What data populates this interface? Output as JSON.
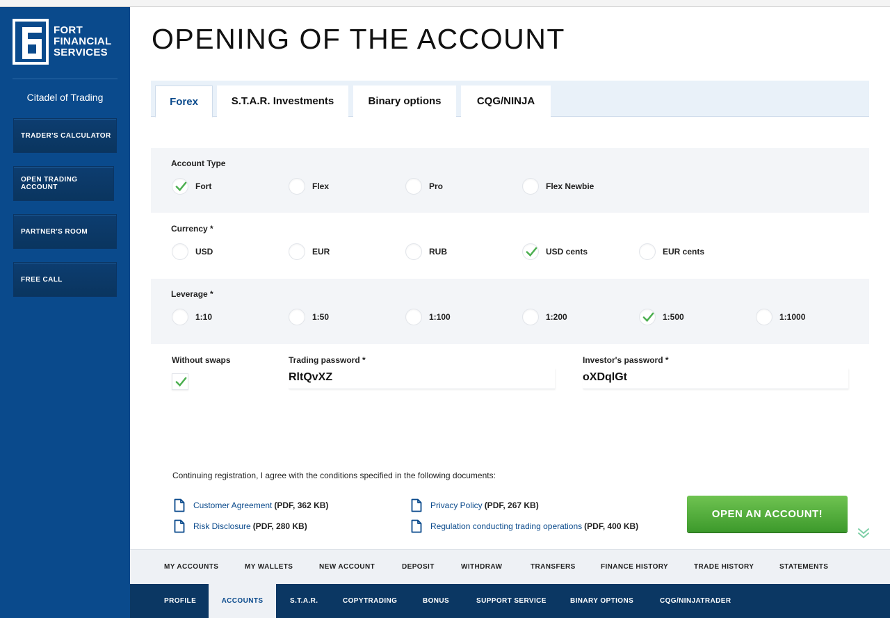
{
  "brand": {
    "logo_text": [
      "FORT",
      "FINANCIAL",
      "SERVICES"
    ],
    "tagline": "Citadel of Trading",
    "color_primary": "#0a4a8c",
    "color_accent": "#4caf50"
  },
  "sidebar": {
    "items": [
      {
        "label": "TRADER'S CALCULATOR"
      },
      {
        "label": "OPEN TRADING ACCOUNT"
      },
      {
        "label": "PARTNER'S ROOM"
      },
      {
        "label": "FREE CALL"
      }
    ]
  },
  "page": {
    "title": "OPENING OF THE ACCOUNT"
  },
  "tabs": [
    {
      "label": "Forex",
      "active": true
    },
    {
      "label": "S.T.A.R. Investments",
      "active": false
    },
    {
      "label": "Binary options",
      "active": false
    },
    {
      "label": "CQG/NINJA",
      "active": false
    }
  ],
  "account_type": {
    "label": "Account Type",
    "options": [
      {
        "label": "Fort",
        "selected": true
      },
      {
        "label": "Flex",
        "selected": false
      },
      {
        "label": "Pro",
        "selected": false
      },
      {
        "label": "Flex Newbie",
        "selected": false
      }
    ]
  },
  "currency": {
    "label": "Currency *",
    "options": [
      {
        "label": "USD",
        "selected": false
      },
      {
        "label": "EUR",
        "selected": false
      },
      {
        "label": "RUB",
        "selected": false
      },
      {
        "label": "USD cents",
        "selected": true
      },
      {
        "label": "EUR cents",
        "selected": false
      }
    ]
  },
  "leverage": {
    "label": "Leverage *",
    "options": [
      {
        "label": "1:10",
        "selected": false
      },
      {
        "label": "1:50",
        "selected": false
      },
      {
        "label": "1:100",
        "selected": false
      },
      {
        "label": "1:200",
        "selected": false
      },
      {
        "label": "1:500",
        "selected": true
      },
      {
        "label": "1:1000",
        "selected": false
      }
    ]
  },
  "swaps": {
    "label": "Without swaps",
    "checked": true
  },
  "trading_password": {
    "label": "Trading password *",
    "value": "RltQvXZ"
  },
  "investor_password": {
    "label": "Investor's password *",
    "value": "oXDqlGt"
  },
  "agreement": {
    "text": "Continuing registration, I agree with the conditions specified in the following documents:",
    "documents": [
      {
        "link": "Customer Agreement",
        "size": "(PDF, 362 KB)"
      },
      {
        "link": "Risk Disclosure",
        "size": "(PDF, 280 KB)"
      },
      {
        "link": "Privacy Policy",
        "size": "(PDF, 267 KB)"
      },
      {
        "link": "Regulation conducting trading operations",
        "size": "(PDF, 400 KB)"
      }
    ]
  },
  "submit": {
    "label": "OPEN AN ACCOUNT!"
  },
  "bottom_nav_primary": [
    {
      "label": "MY ACCOUNTS"
    },
    {
      "label": "MY WALLETS"
    },
    {
      "label": "NEW ACCOUNT"
    },
    {
      "label": "DEPOSIT"
    },
    {
      "label": "WITHDRAW"
    },
    {
      "label": "TRANSFERS"
    },
    {
      "label": "FINANCE HISTORY"
    },
    {
      "label": "TRADE HISTORY"
    },
    {
      "label": "STATEMENTS"
    }
  ],
  "bottom_nav_secondary": [
    {
      "label": "PROFILE",
      "active": false
    },
    {
      "label": "ACCOUNTS",
      "active": true
    },
    {
      "label": "S.T.A.R.",
      "active": false
    },
    {
      "label": "COPYTRADING",
      "active": false
    },
    {
      "label": "BONUS",
      "active": false
    },
    {
      "label": "SUPPORT SERVICE",
      "active": false
    },
    {
      "label": "BINARY OPTIONS",
      "active": false
    },
    {
      "label": "CQG/NINJATRADER",
      "active": false
    }
  ]
}
